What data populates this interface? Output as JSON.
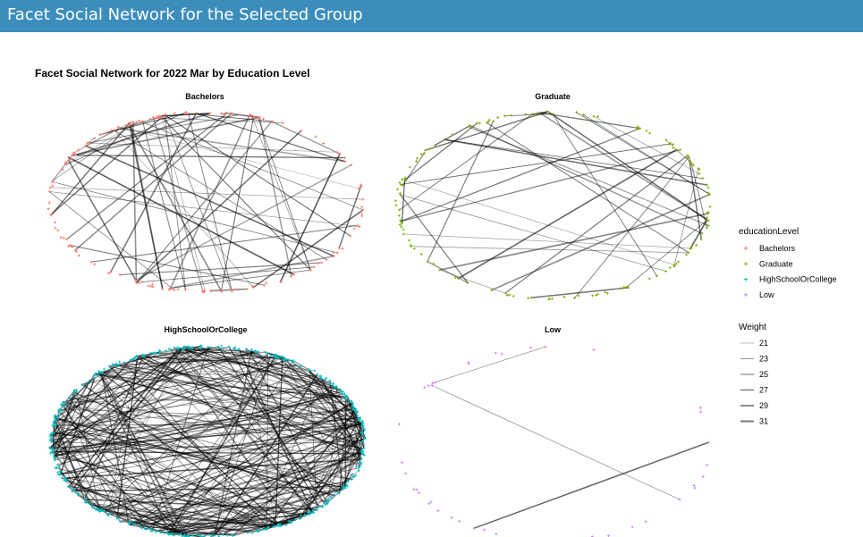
{
  "header": {
    "title": "Facet Social Network for the Selected Group"
  },
  "colors": {
    "header_bg": "#3c8dbc",
    "Bachelors": "#f8766d",
    "Graduate": "#7cae00",
    "HighSchoolOrCollege": "#00bfc4",
    "Low": "#c77cff"
  },
  "chart_data": {
    "type": "network",
    "title": "Facet Social Network for 2022 Mar by Education Level",
    "facets": [
      {
        "name": "Bachelors",
        "nodes": 160,
        "edges": 70
      },
      {
        "name": "Graduate",
        "nodes": 140,
        "edges": 45
      },
      {
        "name": "HighSchoolOrCollege",
        "nodes": 420,
        "edges": 320
      },
      {
        "name": "Low",
        "nodes": 40,
        "edges": 3
      }
    ],
    "legend": {
      "color": {
        "title": "educationLevel",
        "entries": [
          "Bachelors",
          "Graduate",
          "HighSchoolOrCollege",
          "Low"
        ]
      },
      "weight": {
        "title": "Weight",
        "entries": [
          "21",
          "23",
          "25",
          "27",
          "29",
          "31"
        ]
      }
    }
  }
}
